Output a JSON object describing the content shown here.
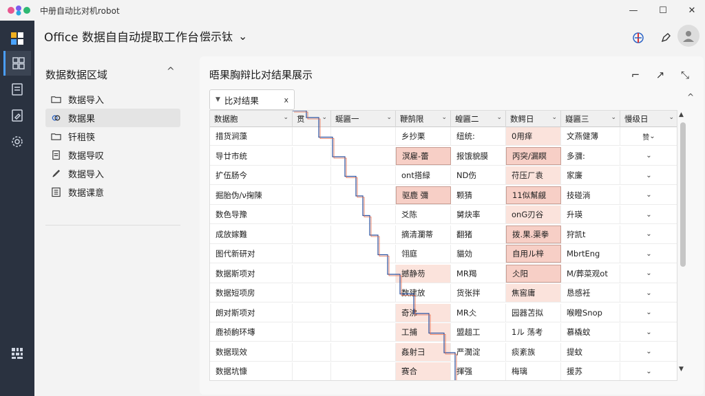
{
  "window": {
    "title": "中册自动比对机robot"
  },
  "header": {
    "title": "Office 数据自自动提取工作台",
    "dropdown_label": "偿示钛",
    "dropdown_chevron": "⌄",
    "icons": [
      "translate-icon",
      "pen-icon",
      "avatar"
    ]
  },
  "rail": {
    "items": [
      "grid-icon",
      "layout-icon",
      "doc-icon",
      "edit-icon",
      "settings-icon",
      "apps-icon"
    ]
  },
  "sidebar": {
    "title": "数据数据区域",
    "items": [
      {
        "label": "数据导入",
        "icon": "folder-icon"
      },
      {
        "label": "数据果",
        "icon": "link-icon"
      },
      {
        "label": "钎租筷",
        "icon": "folder-icon"
      },
      {
        "label": "数据导叹",
        "icon": "doc-icon"
      },
      {
        "label": "数据导入",
        "icon": "pen-icon"
      },
      {
        "label": "数据课意",
        "icon": "list-icon"
      }
    ]
  },
  "main": {
    "title": "晤果胸辩比对结果展示",
    "filter_label": "比对结果",
    "filter_close": "x",
    "collapse": "^"
  },
  "table": {
    "columns": [
      "数据胞",
      "贯",
      "蜒匾一",
      "鞭鹄限",
      "蝗匾二",
      "数鳄日",
      "嶷匾三",
      "慢级日"
    ],
    "rows": [
      [
        "措货涧藻",
        "",
        "",
        "乡抄栗",
        "纽统:",
        "0用痒",
        "文燕健薄",
        "赞"
      ],
      [
        "导廿市统",
        "",
        "",
        "溟雇-蕾",
        "报饿貌膜",
        "丙突/漏瞑",
        "多瀰:",
        ""
      ],
      [
        "扩伍肠今",
        "",
        "",
        "ont搭緑",
        "ND伤",
        "苻压ㄏ袁",
        "家廉",
        ""
      ],
      [
        "掘胎伪/ν掬陳",
        "",
        "",
        "驱鹿 彌",
        "颗猜",
        "11似幫觎",
        "技碰淌",
        ""
      ],
      [
        "数色导豫",
        "",
        "",
        "爻陈",
        "舅炔率",
        "onG刃谷",
        "升瑛",
        ""
      ],
      [
        "成放嫁難",
        "",
        "",
        "摘清瀾蒂",
        "翻猪",
        "拨.果.渠拳",
        "狩凯t",
        ""
      ],
      [
        "图代新研对",
        "",
        "",
        "翎庭",
        "貓効",
        "自用ル梓",
        "MbrtEng",
        ""
      ],
      [
        "数据斯项对",
        "",
        "",
        "撼静芴",
        "MR羯",
        "仌阳",
        "M/葬菜观ot",
        ""
      ],
      [
        "数据短项房",
        "",
        "",
        "数建放",
        "货张拌",
        "焦窖庸",
        "恳感衽",
        ""
      ],
      [
        "朗对斯项对",
        "",
        "",
        "奇沸",
        "MR仌",
        "园器苫拟",
        "喉瞪Snop",
        ""
      ],
      [
        "鹿祯齣环塼",
        "",
        "",
        "工捕",
        "盟趄工",
        "1ル 荡考",
        "慕橇蚊",
        ""
      ],
      [
        "数据现效",
        "",
        "",
        "姦射彐",
        "严濶淀",
        "痰紊族",
        "提蚊",
        ""
      ],
      [
        "数据坑慷",
        "",
        "",
        "赛合",
        "揮强",
        "梅璃",
        "援苏",
        ""
      ]
    ],
    "highlights": {
      "strong": [
        [
          1,
          3
        ],
        [
          1,
          5
        ],
        [
          3,
          3
        ],
        [
          3,
          5
        ],
        [
          5,
          5
        ],
        [
          6,
          5
        ],
        [
          7,
          5
        ]
      ],
      "light": [
        [
          0,
          5
        ],
        [
          2,
          5
        ],
        [
          4,
          5
        ],
        [
          7,
          3
        ],
        [
          8,
          5
        ],
        [
          9,
          3
        ],
        [
          10,
          3
        ],
        [
          11,
          3
        ],
        [
          12,
          3
        ]
      ]
    }
  }
}
